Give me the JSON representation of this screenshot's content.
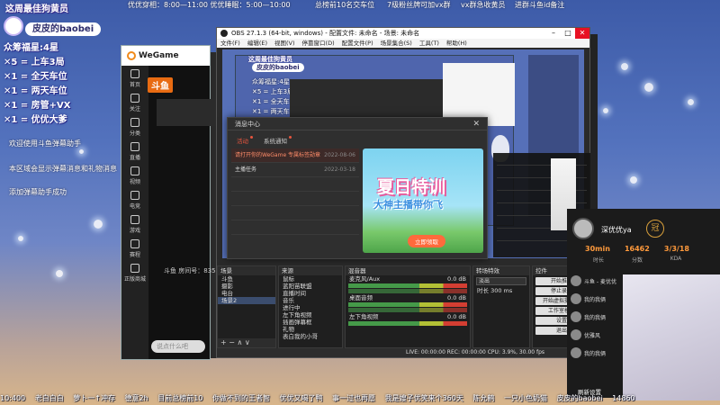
{
  "overlay": {
    "banner": "这周最佳狗黄员",
    "streamer_name": "皮皮的baobei",
    "list": [
      "众筹福星:4星",
      "✕5 = 上车3局",
      "✕1 = 全天车位",
      "✕1 = 两天车位",
      "✕1 = 房管+VX",
      "✕1 = 优优大爹"
    ],
    "left_messages": [
      "欢迎使用斗鱼弹幕助手",
      "本区域会显示弹幕消息和礼物消息",
      "添加弹幕助手成功"
    ],
    "ticker": [
      "优优穿相：8:00—11:00 优优睡眠：5:00—10:00",
      "总榜前10名交车位",
      "7级粉丝牌可加vx群",
      "vx群急收黄员",
      "进群斗鱼id备注"
    ]
  },
  "wegame": {
    "title": "WeGame",
    "sidebar": [
      "首页",
      "关注",
      "分类",
      "直播",
      "视频",
      "电竞",
      "游戏",
      "赛程",
      "正版商城"
    ],
    "douyu_logo": "斗鱼",
    "room_label": "斗鱼 房间号：8354028",
    "bottom_pill": "说点什么吧"
  },
  "obs": {
    "title": "OBS 27.1.3 (64-bit, windows) - 配置文件: 未命名 - 场景: 未命名",
    "menu": [
      "文件(F)",
      "编辑(E)",
      "视图(V)",
      "停靠窗口(D)",
      "配置文件(P)",
      "场景集合(S)",
      "工具(T)",
      "帮助(H)"
    ],
    "scenes_header": "场景",
    "scenes": [
      "斗鱼",
      "摄影",
      "电台",
      "场景2"
    ],
    "sources_header": "来源",
    "sources": [
      "鼠标",
      "蓝阳苗联盟",
      "直播时间",
      "音乐",
      "进行中",
      "左下角视频",
      "插画弹幕框",
      "礼物",
      "表白我的小哥"
    ],
    "mixer_header": "混音器",
    "mixer": [
      {
        "name": "麦克风/Aux",
        "db": "0.0 dB"
      },
      {
        "name": "桌面音频",
        "db": "0.0 dB"
      },
      {
        "name": "左下角视频",
        "db": "0.0 dB"
      }
    ],
    "transitions_header": "转场特效",
    "transition": "淡出",
    "duration_label": "时长",
    "duration": "300 ms",
    "controls_header": "控件",
    "controls": [
      "开始推流",
      "停止录制",
      "开始虚拟摄像机",
      "工作室模式",
      "设置",
      "退出"
    ],
    "status": "LIVE: 00:00:00   REC: 00:00:00   CPU: 3.9%, 30.00 fps"
  },
  "dialog": {
    "title": "消息中心",
    "close": "✕",
    "tabs": [
      "活动",
      "系统通知"
    ],
    "messages": [
      {
        "text": "请打开你的WeGame 专属标签勋章",
        "time": "2022-08-06",
        "active": true
      },
      {
        "text": "主播任务",
        "time": "2022-03-18",
        "active": false
      }
    ],
    "promo_title": "夏日特训",
    "promo_sub": "大神主播带你飞",
    "promo_cta": "立即领取"
  },
  "right_card": {
    "name": "深优优ya",
    "badge": "冠",
    "stats": [
      "30min",
      "16462",
      "3/3/18"
    ],
    "stat_labels": [
      "时长",
      "分数",
      "KDA"
    ],
    "list": [
      "斗鱼 - 麦优优",
      "我的我俩",
      "我的我俩",
      "优雅风",
      "我的我俩"
    ],
    "tab": "刷新设置"
  },
  "marquee": [
    "10:400",
    "老白白白",
    "萝卜一↑冲存",
    "德意2h",
    "目前总榜前10",
    "你做不到的王者智",
    "优优又喝了鸭",
    "事一过也再愿",
    "我是嫂子优笑来个360天",
    "陈允鹤",
    "一只小色奶猫",
    "皮皮的baobei",
    "14860"
  ]
}
